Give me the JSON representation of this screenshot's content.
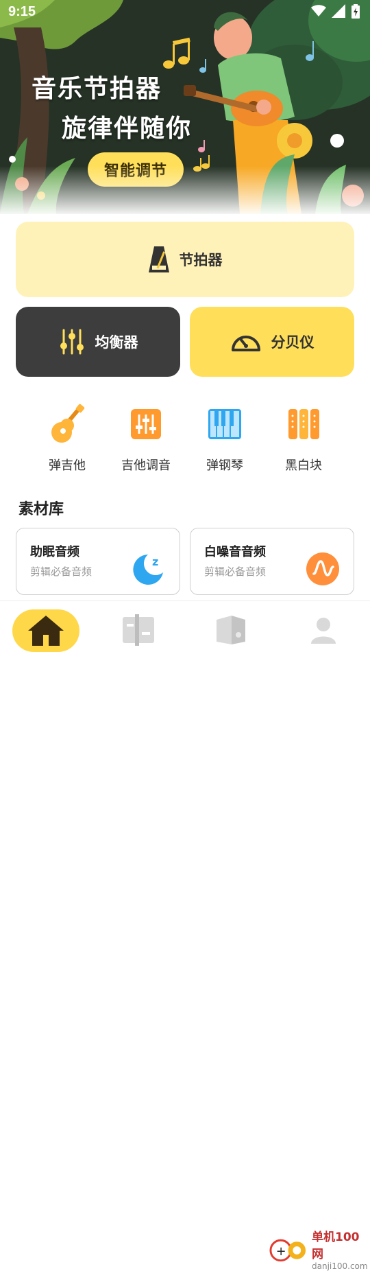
{
  "status": {
    "time": "9:15"
  },
  "banner": {
    "title_line1": "音乐节拍器",
    "title_line2": "旋律伴随你",
    "pill_label": "智能调节"
  },
  "cards": {
    "metronome": "节拍器",
    "equalizer": "均衡器",
    "decibel": "分贝仪"
  },
  "tools": [
    {
      "label": "弹吉他",
      "icon": "guitar-icon"
    },
    {
      "label": "吉他调音",
      "icon": "tuner-sliders-icon"
    },
    {
      "label": "弹钢琴",
      "icon": "piano-icon"
    },
    {
      "label": "黑白块",
      "icon": "piano-tiles-icon"
    }
  ],
  "library": {
    "title": "素材库",
    "items": [
      {
        "title": "助眠音频",
        "subtitle": "剪辑必备音频",
        "icon": "moon-sleep-icon"
      },
      {
        "title": "白噪音音频",
        "subtitle": "剪辑必备音频",
        "icon": "wave-icon"
      }
    ]
  },
  "nav": {
    "items": [
      "home-icon",
      "edit-icon",
      "library-icon",
      "profile-icon"
    ]
  },
  "watermark": {
    "line1": "单机100网",
    "line2": "danji100.com"
  },
  "colors": {
    "accent_yellow": "#ffdf5a",
    "light_yellow": "#fff2b8",
    "dark_card": "#3d3d3d",
    "orange": "#ff9a2e",
    "blue": "#2ea6f0"
  }
}
